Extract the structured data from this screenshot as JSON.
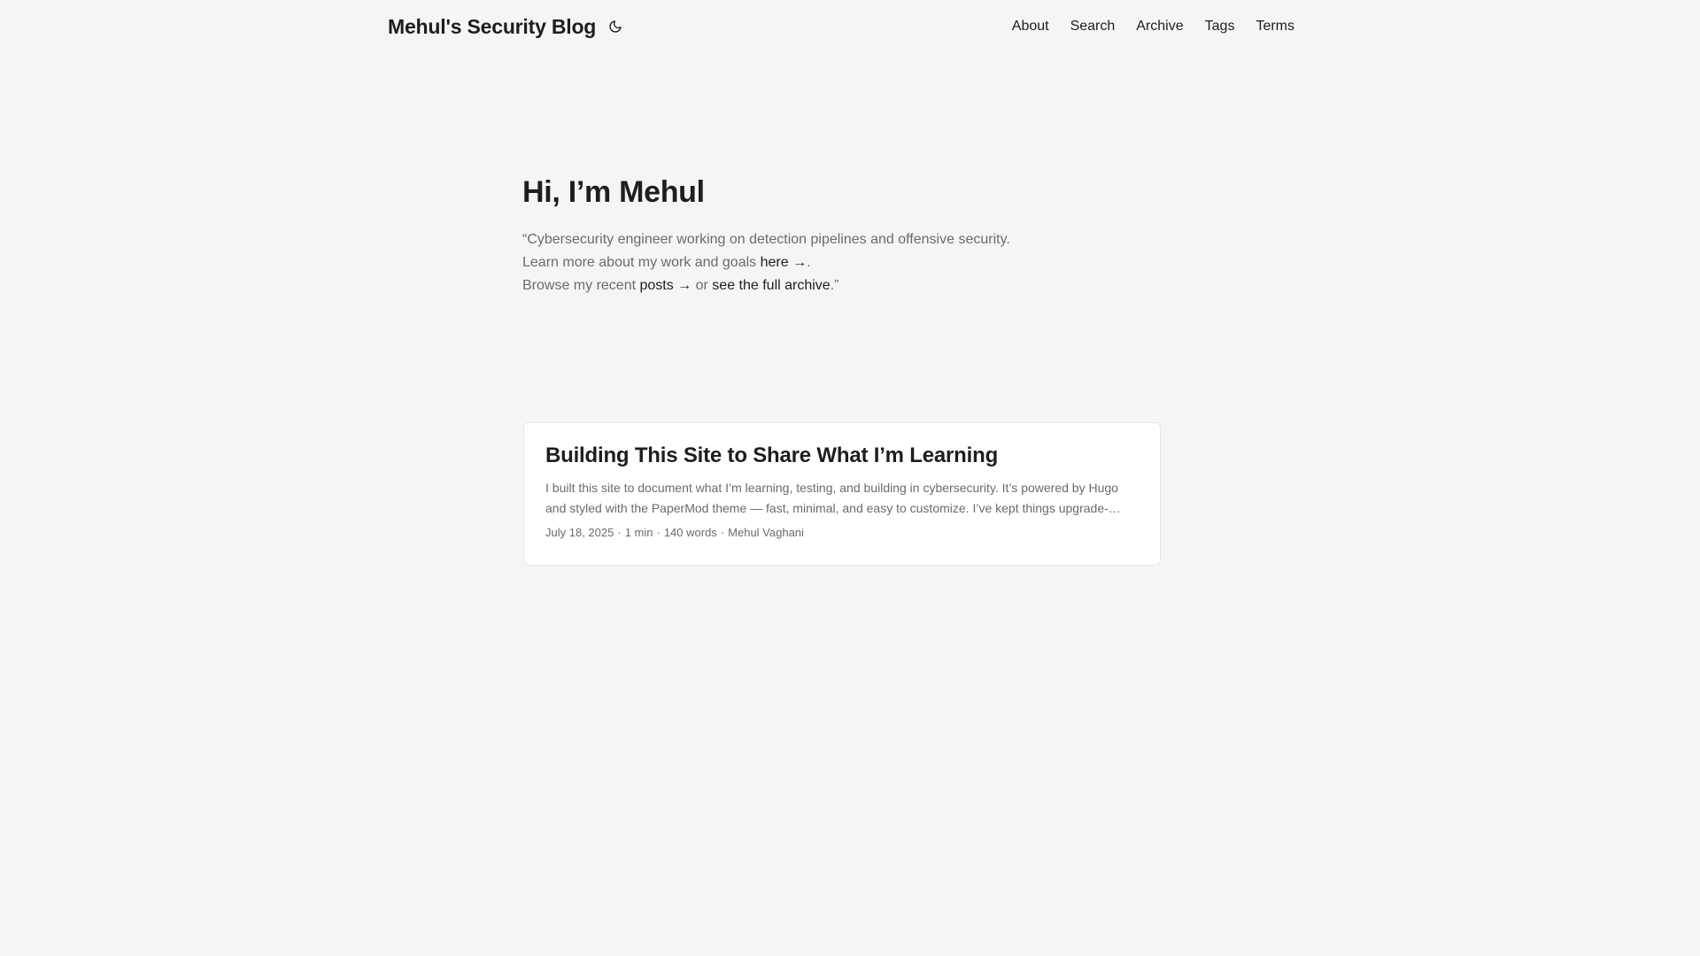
{
  "header": {
    "site_title": "Mehul's Security Blog",
    "theme_toggle_icon": "moon-icon",
    "nav": [
      {
        "label": "About"
      },
      {
        "label": "Search"
      },
      {
        "label": "Archive"
      },
      {
        "label": "Tags"
      },
      {
        "label": "Terms"
      }
    ]
  },
  "intro": {
    "title": "Hi, I’m Mehul",
    "line1": "“Cybersecurity engineer working on detection pipelines and offensive security.",
    "line2_prefix": "Learn more about my work and goals ",
    "line2_link": "here →",
    "line2_suffix": ".",
    "line3_prefix": "Browse my recent ",
    "line3_link1": "posts →",
    "line3_mid": " or ",
    "line3_link2": "see the full archive",
    "line3_suffix": ".”"
  },
  "post": {
    "title": "Building This Site to Share What I’m Learning",
    "summary": "I built this site to document what I’m learning, testing, and building in cybersecurity. It’s powered by Hugo and styled with the PaperMod theme — fast, minimal, and easy to customize. I’ve kept things upgrade-safe...",
    "date": "July 18, 2025",
    "reading_time": "1 min",
    "word_count": "140 words",
    "author": "Mehul Vaghani",
    "separator": "·"
  }
}
